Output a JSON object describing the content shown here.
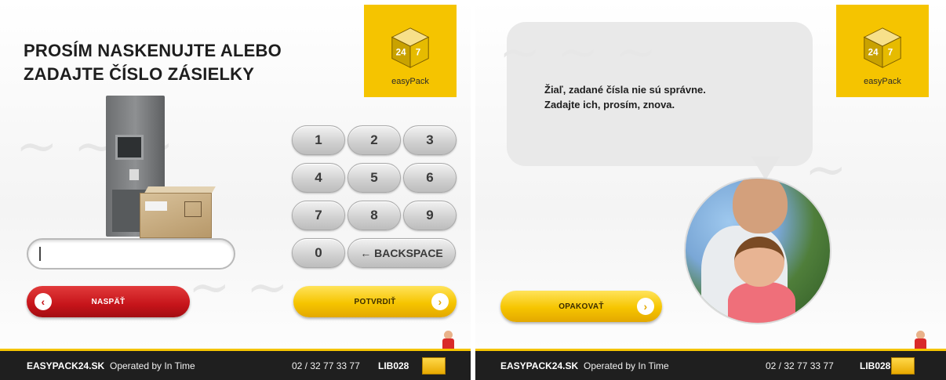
{
  "brand": {
    "name": "easyPack",
    "accent_yellow": "#f5c400",
    "red": "#c6141a"
  },
  "left_screen": {
    "title_line1": "PROSÍM NASKENUJTE ALEBO",
    "title_line2": "ZADAJTE ČÍSLO ZÁSIELKY",
    "input": {
      "value": "",
      "placeholder": ""
    },
    "keypad": {
      "keys": [
        "1",
        "2",
        "3",
        "4",
        "5",
        "6",
        "7",
        "8",
        "9",
        "0"
      ],
      "backspace_label": "← BACKSPACE"
    },
    "back_button": {
      "label": "NASPÄŤ",
      "icon": "chevron-left-icon"
    },
    "confirm_button": {
      "label": "POTVRDIŤ",
      "icon": "chevron-right-icon"
    }
  },
  "right_screen": {
    "message_line1": "Žiaľ, zadané čísla nie sú správne.",
    "message_line2": "Zadajte ich, prosím, znova.",
    "repeat_button": {
      "label": "OPAKOVAŤ",
      "icon": "chevron-right-icon"
    }
  },
  "footer": {
    "website": "EASYPACK24.SK",
    "operator": "Operated by In Time",
    "phone": "02 / 32 77 33 77",
    "terminal_id": "LIB028"
  }
}
